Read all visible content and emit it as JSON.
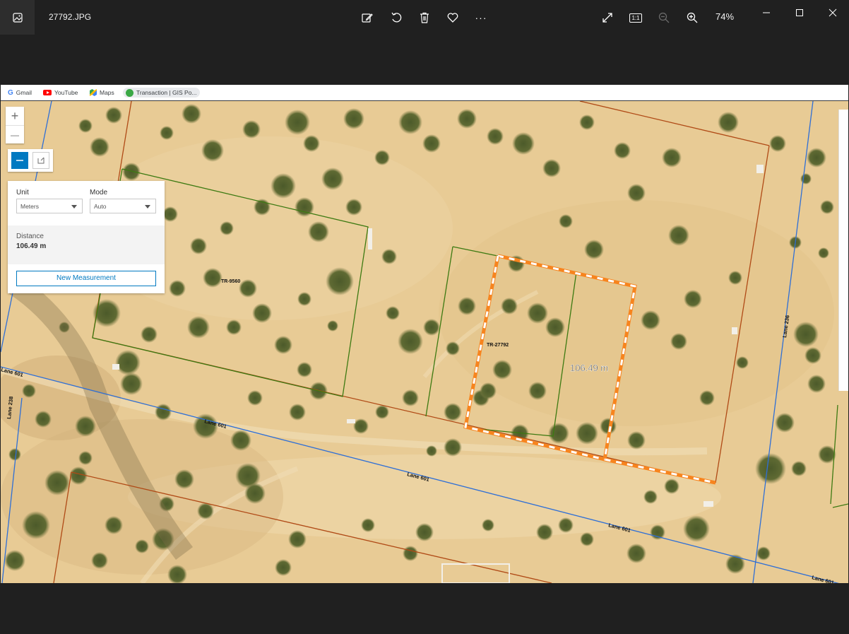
{
  "viewer": {
    "file_name": "27792.JPG",
    "zoom_level": "74%",
    "toolbar_icons": [
      "edit-image-icon",
      "rotate-icon",
      "delete-icon",
      "favorite-icon",
      "more-icon"
    ],
    "view_icons": [
      "fullscreen-icon",
      "actual-size-icon",
      "zoom-out-icon",
      "zoom-in-icon"
    ],
    "actual_size_label": "1:1",
    "more_label": "···"
  },
  "bookmarks": [
    {
      "label": "Gmail",
      "icon": "google-icon"
    },
    {
      "label": "YouTube",
      "icon": "youtube-icon"
    },
    {
      "label": "Maps",
      "icon": "maps-icon"
    },
    {
      "label": "Transaction | GIS Po...",
      "icon": "gis-portal-icon"
    }
  ],
  "map_widgets": {
    "zoom_in": "+",
    "zoom_out": "—"
  },
  "measurement": {
    "unit_label": "Unit",
    "unit_value": "Meters",
    "mode_label": "Mode",
    "mode_value": "Auto",
    "distance_label": "Distance",
    "distance_value": "106.49 m",
    "new_button": "New Measurement"
  },
  "map_labels": {
    "parcel_a": "TR-9560",
    "parcel_b": "TR-27792",
    "measure_label": "106.49 m",
    "road_1": "Lane 601",
    "road_2": "Lane 601",
    "road_3": "Lane 601",
    "road_4": "Lane 601",
    "road_5": "Lane 601",
    "road_236": "Lane 236",
    "road_238": "Lane 238"
  },
  "colors": {
    "sand": "#e6c892",
    "parcel_green": "#3d7a12",
    "parcel_brown": "#b04a16",
    "road_blue": "#2f6fd6",
    "measure_orange": "#f7841e",
    "accent": "#0079c1"
  }
}
